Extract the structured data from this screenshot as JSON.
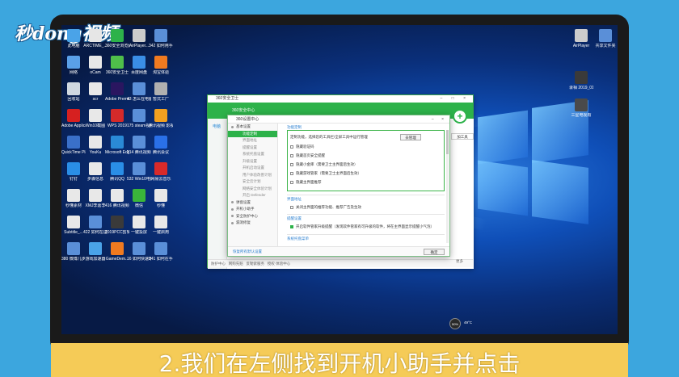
{
  "watermark": {
    "logo_text": "秒dong视频"
  },
  "desktop_icons": [
    {
      "label": "此电脑",
      "color": "#4aa3e8"
    },
    {
      "label": "ARCTIME_...",
      "color": "#e6e6e6"
    },
    {
      "label": "360安全浏览器",
      "color": "#2db24a"
    },
    {
      "label": "AirPlayer...",
      "color": "#cccccc"
    },
    {
      "label": "342 如何用手机桌面...",
      "color": "#5a8fd8"
    },
    {
      "label": "网络",
      "color": "#5aa0e8"
    },
    {
      "label": "oCam",
      "color": "#e8e8e8"
    },
    {
      "label": "360安全卫士",
      "color": "#4fbf4a"
    },
    {
      "label": "百度网盘",
      "color": "#3a8ee6"
    },
    {
      "label": "淘宝体验",
      "color": "#f07a20"
    },
    {
      "label": "回收站",
      "color": "#d0d8e0"
    },
    {
      "label": "scr",
      "color": "#e8e8e8"
    },
    {
      "label": "Adobe Premiere P...",
      "color": "#2a1660"
    },
    {
      "label": "43 怎么在电脑上安装软件",
      "color": "#5a8fd8"
    },
    {
      "label": "暂式工厂",
      "color": "#b0b0b0"
    },
    {
      "label": "Adobe Applicati...",
      "color": "#d62020"
    },
    {
      "label": "Win10截图",
      "color": "#e8e8e8"
    },
    {
      "label": "WPS 2019",
      "color": "#d42a2a"
    },
    {
      "label": "175 steam视频...",
      "color": "#5a8fd8"
    },
    {
      "label": "腾讯视频 影视",
      "color": "#f2a020"
    },
    {
      "label": "QuickTime Player",
      "color": "#3a70c8"
    },
    {
      "label": "YouKu",
      "color": "#e8e8e8"
    },
    {
      "label": "Microsoft Edge",
      "color": "#2a8ad6"
    },
    {
      "label": "214 腾讯视频怎么下载...",
      "color": "#5a8fd8"
    },
    {
      "label": "腾讯会议",
      "color": "#2a70e8"
    },
    {
      "label": "钉钉",
      "color": "#2a8ee6"
    },
    {
      "label": "步骤信息",
      "color": "#e8e8e8"
    },
    {
      "label": "腾讯QQ",
      "color": "#2a8ee6"
    },
    {
      "label": "532 Win10电脑怎么...",
      "color": "#5a8fd8"
    },
    {
      "label": "网易云音乐",
      "color": "#d82a2a"
    },
    {
      "label": "秒懂素材",
      "color": "#e8e8e8"
    },
    {
      "label": "XMJ李嘉李",
      "color": "#e8e8e8"
    },
    {
      "label": "416 腾讯视频..."
    },
    {
      "label": "微信",
      "color": "#3ab53a"
    },
    {
      "label": "秒懂",
      "color": "#e8e8e8"
    },
    {
      "label": "Subtitle_...",
      "color": "#e8e8e8"
    },
    {
      "label": "422 如何在这一电脑...",
      "color": "#5a8fd8"
    },
    {
      "label": "2019PCC剪辑",
      "color": "#3a3a3a"
    },
    {
      "label": "一键投屏",
      "color": "#e8e8e8"
    },
    {
      "label": "一键启用",
      "color": "#e8e8e8"
    },
    {
      "label": "380 微博几步看到...",
      "color": "#5a8fd8"
    },
    {
      "label": "游戏加速器",
      "color": "#4aa3e8"
    },
    {
      "label": "GameDem...",
      "color": "#f07a20"
    },
    {
      "label": "16 如何快速增加...",
      "color": "#5a8fd8"
    },
    {
      "label": "341 如何在手机上申请...",
      "color": "#5a8fd8"
    }
  ],
  "right_icons": [
    {
      "label": "AirPlayer",
      "color": "#cccccc"
    },
    {
      "label": "共享文件夹",
      "color": "#5a8fd8"
    },
    {
      "label": "录相 2019_01_...",
      "color": "#3a3a3a"
    },
    {
      "label": "三星电视有",
      "color": "#4a4a4a"
    }
  ],
  "security_window": {
    "title": "360安全卫士",
    "header_text": "360安全中心",
    "side_label": "电脑",
    "footer_tabs": [
      "防护中心",
      "网购先赔",
      "反勒索服务",
      "授权·体验中心"
    ],
    "right_search": "加工具",
    "right_more": "更多"
  },
  "dialog": {
    "title": "360设置中心",
    "nav": [
      {
        "label": "基本设置",
        "level": "top",
        "active": false
      },
      {
        "label": "功能定制",
        "level": "sub",
        "active": true
      },
      {
        "label": "界面地址",
        "level": "sub",
        "active": false
      },
      {
        "label": "提醒设置",
        "level": "sub",
        "active": false
      },
      {
        "label": "系统托盘设置",
        "level": "sub",
        "active": false
      },
      {
        "label": "升级设置",
        "level": "sub",
        "active": false
      },
      {
        "label": "开机启动设置",
        "level": "sub",
        "active": false
      },
      {
        "label": "用户体验改善计划",
        "level": "sub",
        "active": false
      },
      {
        "label": "安全云计划",
        "level": "sub",
        "active": false
      },
      {
        "label": "网络安全体验计划",
        "level": "sub",
        "active": false
      },
      {
        "label": "开启 Defender",
        "level": "sub",
        "active": false
      },
      {
        "label": "弹窗设置",
        "level": "top",
        "active": false
      },
      {
        "label": "开机小助手",
        "level": "top",
        "active": false
      },
      {
        "label": "安全防护中心",
        "level": "top",
        "active": false
      },
      {
        "label": "漏洞修复",
        "level": "top",
        "active": false
      }
    ],
    "group1": {
      "title": "功能定制",
      "desc": "定制功能，选择您的工具栏/全屏工具中运行管理",
      "manage_button": "去管理",
      "options": [
        {
          "label": "隐藏验证码",
          "checked": false
        },
        {
          "label": "隐藏首页安全提醒",
          "checked": false
        },
        {
          "label": "隐藏小金库（需要卫士主界面后生效）",
          "checked": false
        },
        {
          "label": "隐藏游戏管家（需要卫士主界面后生效）",
          "checked": false
        },
        {
          "label": "隐藏主界面推荐"
        }
      ]
    },
    "group2": {
      "title": "界面地址",
      "option": "关闭主界面的推荐功能、推荐广告及生效"
    },
    "group3": {
      "title": "提醒设置",
      "option": "开启软件管家升级提醒（发现软件管家有可升级的软件，将在主界面显示提醒小气泡）"
    },
    "group4": {
      "title": "系统托盘菜单"
    },
    "footer_link": "恢复所有默认设置",
    "ok_button": "确定"
  },
  "tray": {
    "percent": "50%",
    "temp": "49°C"
  },
  "caption": "2.我们在左侧找到开机小助手并点击"
}
